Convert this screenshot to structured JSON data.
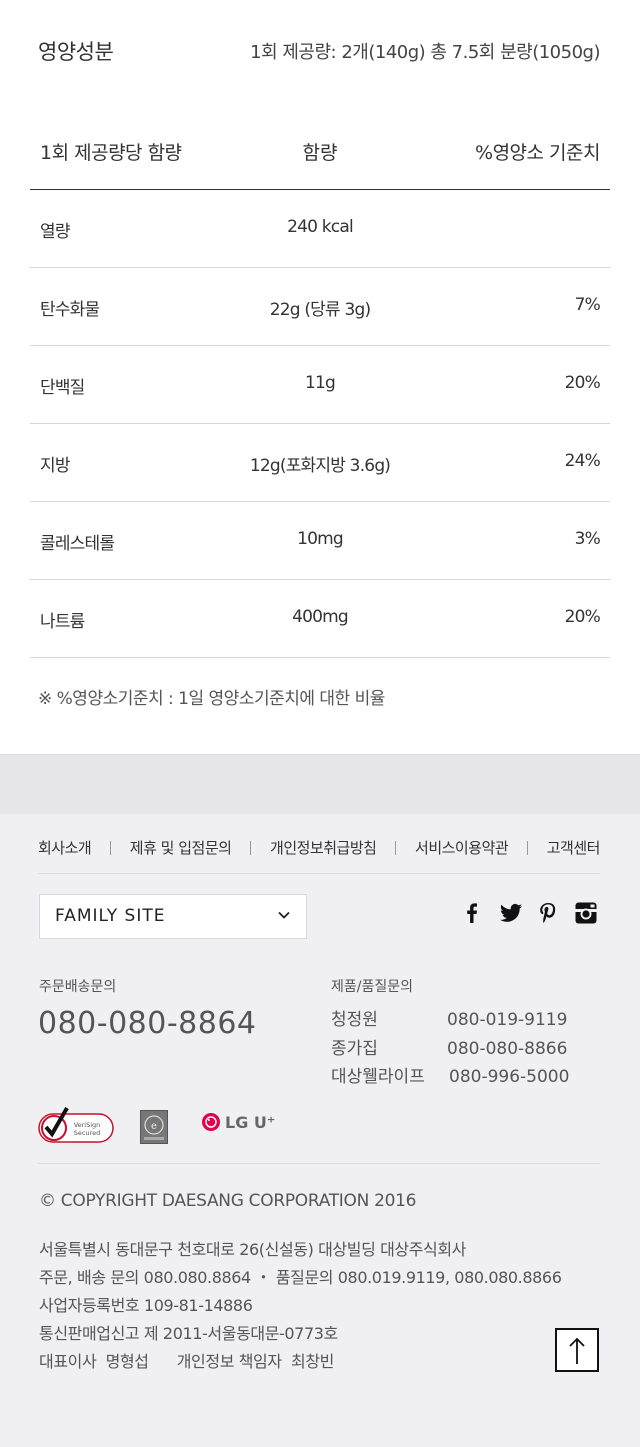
{
  "nutrition": {
    "title": "영양성분",
    "serving": "1회 제공량: 2개(140g) 총 7.5회 분량(1050g)",
    "headers": {
      "item": "1회 제공량당 함량",
      "amount": "함량",
      "percent": "%영양소 기준치"
    },
    "rows": [
      {
        "name": "열량",
        "amount": "240 kcal",
        "percent": ""
      },
      {
        "name": "탄수화물",
        "amount": "22g (당류 3g)",
        "percent": "7%"
      },
      {
        "name": "단백질",
        "amount": "11g",
        "percent": "20%"
      },
      {
        "name": "지방",
        "amount": "12g(포화지방 3.6g)",
        "percent": "24%"
      },
      {
        "name": "콜레스테롤",
        "amount": "10mg",
        "percent": "3%"
      },
      {
        "name": "나트륨",
        "amount": "400mg",
        "percent": "20%"
      }
    ],
    "note": "※ %영양소기준치 : 1일 영양소기준치에 대한 비율"
  },
  "footer": {
    "links": [
      "회사소개",
      "제휴 및 입점문의",
      "개인정보취급방침",
      "서비스이용약관",
      "고객센터"
    ],
    "family_site": "FAMILY SITE",
    "social": [
      "facebook-icon",
      "twitter-icon",
      "pinterest-icon",
      "instagram-icon"
    ],
    "order": {
      "label": "주문배송문의",
      "phone": "080-080-8864"
    },
    "quality": {
      "label": "제품/품질문의",
      "items": [
        {
          "name": "청정원",
          "phone": "080-019-9119"
        },
        {
          "name": "종가집",
          "phone": "080-080-8866"
        },
        {
          "name": "대상웰라이프",
          "phone": "080-996-5000"
        }
      ]
    },
    "certs": {
      "verisign": "VeriSign Secured",
      "lg": "LG U⁺"
    },
    "copyright": "© COPYRIGHT DAESANG CORPORATION 2016",
    "address": [
      "서울특별시 동대문구 천호대로 26(신설동) 대상빌딩 대상주식회사",
      "주문, 배송 문의 080.080.8864 ・ 품질문의 080.019.9119, 080.080.8866",
      "사업자등록번호 109-81-14886",
      "통신판매업신고 제 2011-서울동대문-0773호",
      "대표이사  명형섭      개인정보 책임자  최창빈"
    ],
    "colors": {
      "footer_bg": "#f0eff2",
      "verisign_red": "#c8102e",
      "lg_red": "#e4004f"
    }
  }
}
